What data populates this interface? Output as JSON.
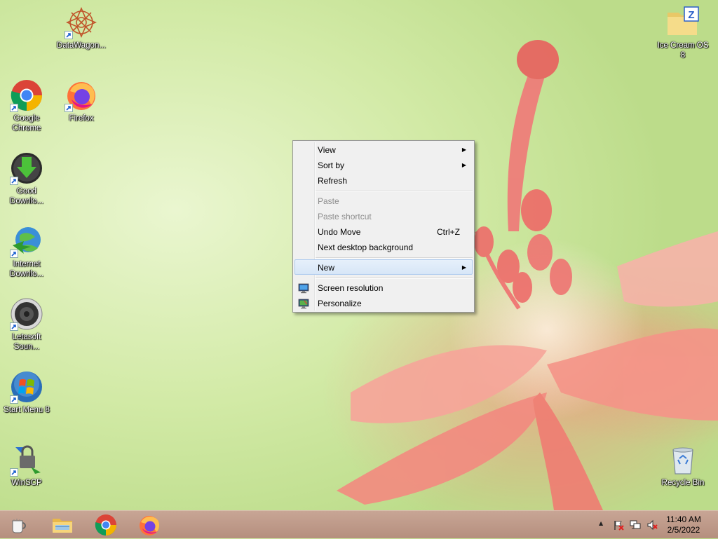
{
  "desktop": {
    "icons": [
      {
        "label": "DataWagon...",
        "icon": "datawagon-icon"
      },
      {
        "label": "Google Chrome",
        "icon": "chrome-icon"
      },
      {
        "label": "Firefox",
        "icon": "firefox-icon"
      },
      {
        "label": "Good Downlo...",
        "icon": "download-icon"
      },
      {
        "label": "Internet Downlo...",
        "icon": "internet-download-manager-icon"
      },
      {
        "label": "Letasoft Soun...",
        "icon": "speaker-icon"
      },
      {
        "label": "Start Menu 8",
        "icon": "start-orb-icon"
      },
      {
        "label": "WinSCP",
        "icon": "winscp-icon"
      },
      {
        "label": "Ice Cream OS 8",
        "icon": "zip-folder-icon"
      },
      {
        "label": "Recycle Bin",
        "icon": "recycle-bin-icon"
      }
    ]
  },
  "context_menu": {
    "items": {
      "view": "View",
      "sort_by": "Sort by",
      "refresh": "Refresh",
      "paste": "Paste",
      "paste_shortcut": "Paste shortcut",
      "undo_move": "Undo Move",
      "undo_move_shortcut": "Ctrl+Z",
      "next_background": "Next desktop background",
      "new": "New",
      "screen_resolution": "Screen resolution",
      "personalize": "Personalize"
    },
    "submenu_arrow": "▶"
  },
  "taskbar": {
    "pinned": [
      "start-icon",
      "file-explorer-icon",
      "chrome-icon",
      "firefox-icon"
    ],
    "tray": {
      "show_hidden_arrow": "▲",
      "time": "11:40 AM",
      "date": "2/5/2022"
    }
  },
  "colors": {
    "menu_bg": "#f0f0f0",
    "menu_highlight": "#d7e6f7",
    "taskbar": "#b58f7e"
  }
}
